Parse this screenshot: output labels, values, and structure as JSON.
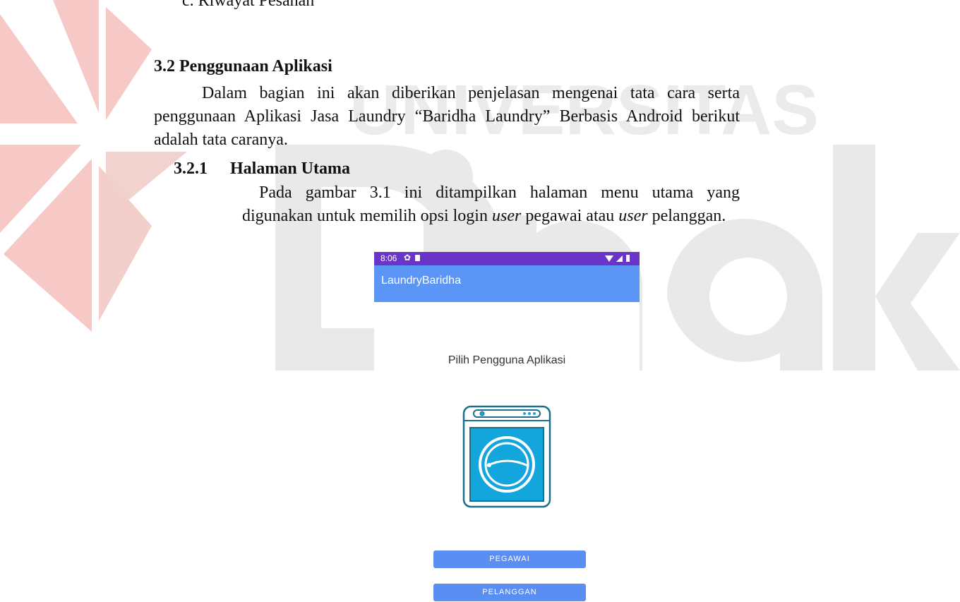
{
  "document": {
    "cutoff_line": "c. Riwayat Pesanan",
    "section_heading": "3.2 Penggunaan Aplikasi",
    "section_paragraph": "Dalam bagian ini akan diberikan penjelasan mengenai tata cara  serta penggunaan Aplikasi Jasa Laundry “Baridha Laundry” Berbasis Android berikut adalah tata caranya.",
    "subsection_number": "3.2.1",
    "subsection_title": "Halaman Utama",
    "subsection_paragraph": {
      "part1": "Pada gambar 3.1 ini ditampilkan halaman menu utama yang digunakan untuk memilih opsi login ",
      "em1": "user",
      "part2": " pegawai atau ",
      "em2": "user",
      "part3": " pelanggan."
    }
  },
  "watermark": {
    "text": "UNIVERSITAS",
    "logo_text": "Dinamika",
    "colors": {
      "logo_red": "#f4c3c0",
      "text_gray": "#e6e6e6"
    }
  },
  "screenshot": {
    "status_bar": {
      "time": "8:06",
      "icons": [
        "gear-icon",
        "sd-card-icon",
        "wifi-icon",
        "signal-icon",
        "battery-icon"
      ]
    },
    "app_bar": {
      "title": "LaundryBaridha"
    },
    "heading": "Pilih Pengguna Aplikasi",
    "illustration": "washing-machine-icon",
    "buttons": {
      "pegawai": "PEGAWAI",
      "pelanggan": "PELANGGAN"
    },
    "colors": {
      "status_bar": "#6a34c9",
      "app_bar": "#5b95f5",
      "button": "#5b8ef2",
      "washer": "#13a6dc"
    }
  }
}
